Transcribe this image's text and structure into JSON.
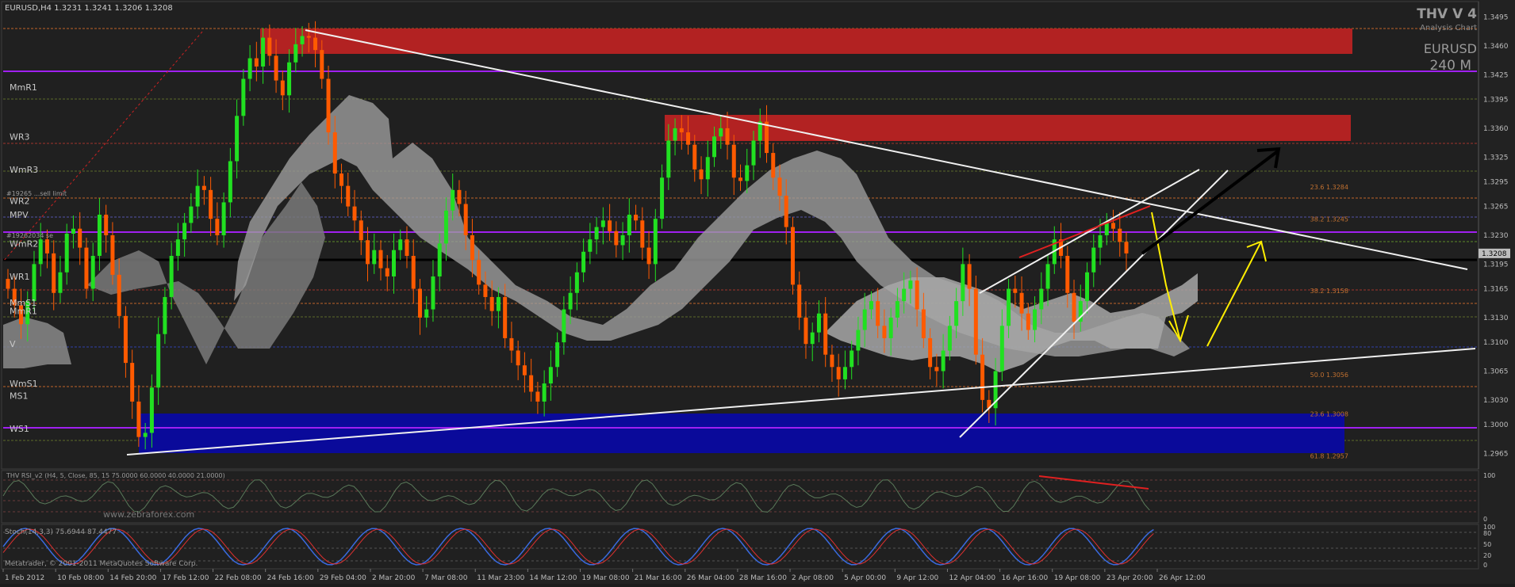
{
  "chart_data": {
    "type": "candlestick",
    "symbol_header": "EURUSD,H4  1.3231 1.3241 1.3206 1.3208",
    "brand": {
      "name": "THV V 4",
      "subtitle": "Analysis Chart",
      "symbol": "EURUSD",
      "timeframe": "240 M"
    },
    "ylim": [
      1.295,
      1.351
    ],
    "y_ticks": [
      1.2965,
      1.3,
      1.303,
      1.3065,
      1.31,
      1.313,
      1.3165,
      1.3195,
      1.323,
      1.3265,
      1.3295,
      1.3325,
      1.336,
      1.3395,
      1.3425,
      1.346,
      1.3495
    ],
    "current_price": 1.3208,
    "x_labels": [
      "1 Feb 2012",
      "10 Feb 08:00",
      "14 Feb 20:00",
      "17 Feb 12:00",
      "22 Feb 08:00",
      "24 Feb 16:00",
      "29 Feb 04:00",
      "2 Mar 20:00",
      "7 Mar 08:00",
      "11 Mar 23:00",
      "14 Mar 12:00",
      "19 Mar 08:00",
      "21 Mar 16:00",
      "26 Mar 04:00",
      "28 Mar 16:00",
      "2 Apr 08:00",
      "5 Apr 00:00",
      "9 Apr 12:00",
      "12 Apr 04:00",
      "16 Apr 16:00",
      "19 Apr 08:00",
      "23 Apr 20:00",
      "26 Apr 12:00"
    ],
    "pivot_labels": [
      {
        "label": "MmR1",
        "price": 1.341
      },
      {
        "label": "WR3",
        "price": 1.335
      },
      {
        "label": "WmR3",
        "price": 1.331
      },
      {
        "label": "WR2",
        "price": 1.3272
      },
      {
        "label": "MPV",
        "price": 1.3255
      },
      {
        "label": "WmR2",
        "price": 1.322
      },
      {
        "label": "WR1",
        "price": 1.318
      },
      {
        "label": "MmS1",
        "price": 1.3148
      },
      {
        "label": "MmR1",
        "price": 1.3138
      },
      {
        "label": "V",
        "price": 1.3098
      },
      {
        "label": "WmS1",
        "price": 1.305
      },
      {
        "label": "MS1",
        "price": 1.3035
      },
      {
        "label": "WS1",
        "price": 1.2995
      }
    ],
    "order_labels": [
      "#19265 ...sell limit",
      "#19262034 se"
    ],
    "fib_labels": [
      {
        "label": "23.6 1.3284",
        "price": 1.3284
      },
      {
        "label": "38.2 1.3245",
        "price": 1.3245
      },
      {
        "label": "38.2 1.3158",
        "price": 1.3158
      },
      {
        "label": "50.0 1.3056",
        "price": 1.3056
      },
      {
        "label": "23.6 1.3008",
        "price": 1.3008
      },
      {
        "label": "61.8 1.2957",
        "price": 1.2957
      }
    ],
    "close_series": [
      1.3165,
      1.3145,
      1.3122,
      1.315,
      1.3195,
      1.3225,
      1.3208,
      1.316,
      1.3185,
      1.3232,
      1.3238,
      1.3215,
      1.3165,
      1.3205,
      1.3255,
      1.323,
      1.3182,
      1.3132,
      1.3075,
      1.3028,
      1.2985,
      1.299,
      1.3045,
      1.311,
      1.3155,
      1.3205,
      1.3225,
      1.3245,
      1.3265,
      1.329,
      1.3285,
      1.325,
      1.323,
      1.327,
      1.332,
      1.3375,
      1.342,
      1.3445,
      1.3435,
      1.347,
      1.3448,
      1.3418,
      1.34,
      1.344,
      1.3462,
      1.3472,
      1.347,
      1.3455,
      1.342,
      1.3355,
      1.3305,
      1.329,
      1.3265,
      1.3248,
      1.3224,
      1.3195,
      1.3212,
      1.319,
      1.318,
      1.3212,
      1.3225,
      1.3205,
      1.3165,
      1.313,
      1.314,
      1.318,
      1.322,
      1.326,
      1.3285,
      1.3268,
      1.323,
      1.32,
      1.317,
      1.3155,
      1.3138,
      1.3155,
      1.3105,
      1.309,
      1.3072,
      1.306,
      1.304,
      1.3028,
      1.305,
      1.307,
      1.31,
      1.314,
      1.316,
      1.3185,
      1.321,
      1.3225,
      1.324,
      1.3248,
      1.3235,
      1.3218,
      1.323,
      1.3255,
      1.3248,
      1.3215,
      1.3195,
      1.325,
      1.33,
      1.3345,
      1.336,
      1.3355,
      1.334,
      1.331,
      1.3298,
      1.3325,
      1.335,
      1.336,
      1.334,
      1.33,
      1.3296,
      1.3315,
      1.3345,
      1.3368,
      1.333,
      1.33,
      1.3278,
      1.324,
      1.317,
      1.313,
      1.3098,
      1.3112,
      1.3135,
      1.3085,
      1.307,
      1.3055,
      1.307,
      1.309,
      1.3115,
      1.314,
      1.315,
      1.312,
      1.3105,
      1.313,
      1.315,
      1.3165,
      1.3175,
      1.314,
      1.3105,
      1.307,
      1.3065,
      1.309,
      1.312,
      1.315,
      1.3195,
      1.3165,
      1.3085,
      1.303,
      1.302,
      1.3065,
      1.312,
      1.3165,
      1.316,
      1.3135,
      1.3115,
      1.314,
      1.3165,
      1.3195,
      1.3225,
      1.3205,
      1.316,
      1.3125,
      1.315,
      1.3185,
      1.3215,
      1.323,
      1.3245,
      1.3238,
      1.3222,
      1.3208
    ]
  },
  "indicators": {
    "rsi_label": "THV RSI_v2 (H4, 5, Close, 85, 15 75.0000 60.0000 40.0000 21.0000)",
    "rsi_axis": [
      "100",
      "0"
    ],
    "stoch_label": "Stoch(14,3,3) 75.6944 87.4477",
    "stoch_axis": [
      "100",
      "80",
      "50",
      "20",
      "0"
    ],
    "watermark": "www.zebraforex.com",
    "footer": "Metatrader, © 2001-2011 MetaQuotes Software Corp."
  }
}
